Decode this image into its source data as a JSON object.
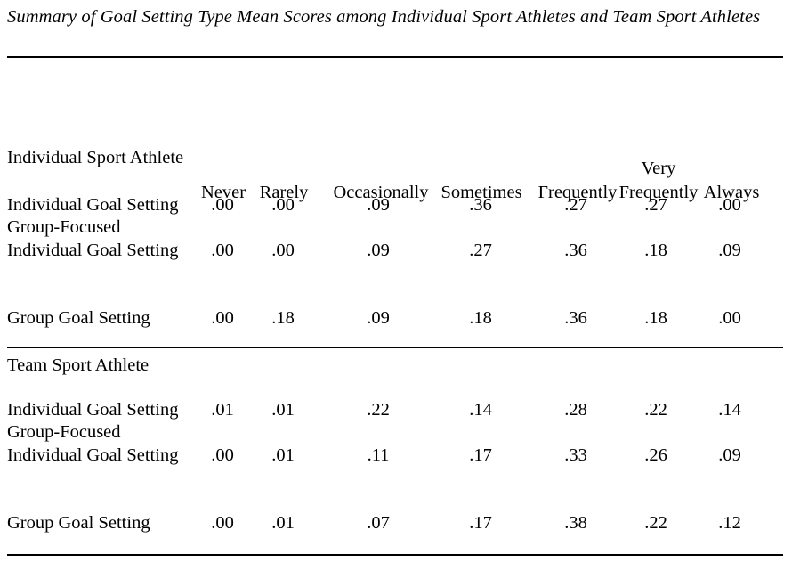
{
  "table": {
    "title": "Summary of Goal Setting Type Mean Scores among Individual Sport Athletes and Team Sport Athletes",
    "columns": [
      {
        "line1": "",
        "line2": "Never"
      },
      {
        "line1": "",
        "line2": "Rarely"
      },
      {
        "line1": "",
        "line2": "Occasionally"
      },
      {
        "line1": "",
        "line2": "Sometimes"
      },
      {
        "line1": "",
        "line2": "Frequently"
      },
      {
        "line1": "Very",
        "line2": "Frequently"
      },
      {
        "line1": "",
        "line2": "Always"
      }
    ],
    "sections": [
      {
        "heading": "Individual Sport Athlete",
        "rows": [
          {
            "label_line1": "",
            "label_line2": "Individual Goal Setting",
            "values": [
              ".00",
              ".00",
              ".09",
              ".36",
              ".27",
              ".27",
              ".00"
            ]
          },
          {
            "label_line1": "Group-Focused",
            "label_line2": "Individual Goal Setting",
            "values": [
              ".00",
              ".00",
              ".09",
              ".27",
              ".36",
              ".18",
              ".09"
            ]
          },
          {
            "label_line1": "",
            "label_line2": "Group Goal Setting",
            "values": [
              ".00",
              ".18",
              ".09",
              ".18",
              ".36",
              ".18",
              ".00"
            ]
          }
        ]
      },
      {
        "heading": "Team Sport Athlete",
        "rows": [
          {
            "label_line1": "",
            "label_line2": "Individual Goal Setting",
            "values": [
              ".01",
              ".01",
              ".22",
              ".14",
              ".28",
              ".22",
              ".14"
            ]
          },
          {
            "label_line1": "Group-Focused",
            "label_line2": "Individual Goal Setting",
            "values": [
              ".00",
              ".01",
              ".11",
              ".17",
              ".33",
              ".26",
              ".09"
            ]
          },
          {
            "label_line1": "",
            "label_line2": "Group Goal Setting",
            "values": [
              ".00",
              ".01",
              ".07",
              ".17",
              ".38",
              ".22",
              ".12"
            ]
          }
        ]
      }
    ]
  }
}
